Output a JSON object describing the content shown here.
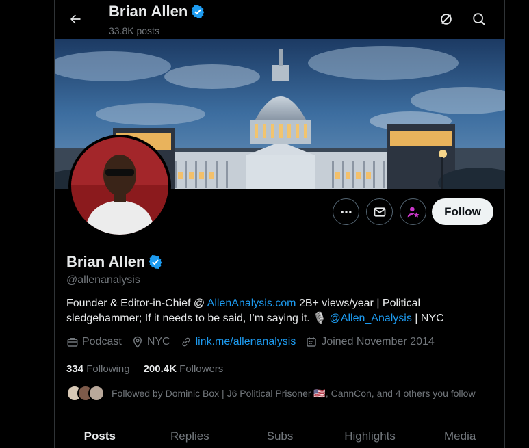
{
  "header": {
    "name": "Brian Allen",
    "posts_count": "33.8K posts"
  },
  "profile": {
    "name": "Brian Allen",
    "handle": "@allenanalysis",
    "follow_label": "Follow",
    "bio": {
      "part1": "Founder & Editor-in-Chief @ ",
      "link1": "AllenAnalysis.com",
      "part2": " 2B+ views/year | Political sledgehammer; If it needs to be said, I’m saying it. ",
      "mic_emoji": "🎙️",
      "part3": " ",
      "link2": "@Allen_Analysis",
      "part4": " | NYC"
    },
    "meta": {
      "category": "Podcast",
      "location": "NYC",
      "website": "link.me/allenanalysis",
      "joined": "Joined November 2014"
    },
    "following_count": "334",
    "following_label": "Following",
    "followers_count": "200.4K",
    "followers_label": "Followers",
    "followed_by": {
      "prefix": "Followed by Dominic Box | J6 Political Prisoner ",
      "flag": "🇺🇸",
      "suffix": ", CannCon, and 4 others you follow"
    }
  },
  "tabs": [
    {
      "label": "Posts",
      "active": true
    },
    {
      "label": "Replies",
      "active": false
    },
    {
      "label": "Subs",
      "active": false
    },
    {
      "label": "Highlights",
      "active": false
    },
    {
      "label": "Media",
      "active": false
    }
  ],
  "colors": {
    "accent": "#1d9bf0",
    "verified": "#1d9bf0",
    "subscribe": "#c936c9",
    "text_secondary": "#71767b"
  }
}
